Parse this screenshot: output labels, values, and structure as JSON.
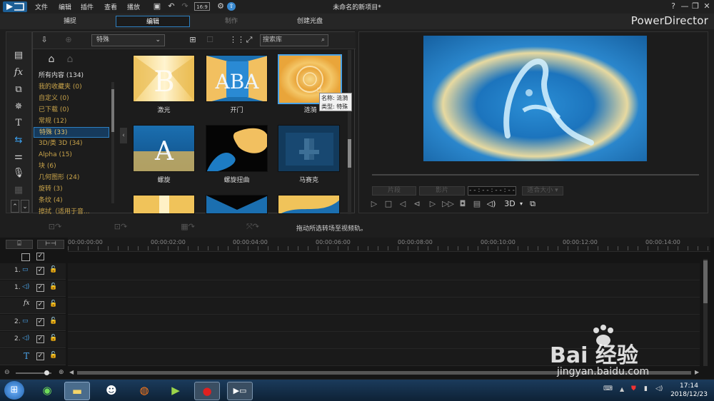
{
  "titlebar": {
    "menu": [
      "文件",
      "编辑",
      "插件",
      "查看",
      "播放"
    ],
    "window_title": "未命名的新项目*",
    "win_controls": [
      "?",
      "—",
      "❐",
      "✕"
    ]
  },
  "modes": {
    "tabs": [
      "捕捉",
      "编辑",
      "制作",
      "创建光盘"
    ],
    "active": "编辑"
  },
  "brand": "PowerDirector",
  "library": {
    "category_select": "特殊",
    "search_placeholder": "搜索库",
    "categories": [
      {
        "label": "所有内容 (134)"
      },
      {
        "label": "我的收藏夹 (0)"
      },
      {
        "label": "自定义 (0)"
      },
      {
        "label": "已下载 (0)"
      },
      {
        "label": "常规 (12)"
      },
      {
        "label": "特殊 (33)"
      },
      {
        "label": "3D/类 3D (34)"
      },
      {
        "label": "Alpha (15)"
      },
      {
        "label": "块 (6)"
      },
      {
        "label": "几何图形 (24)"
      },
      {
        "label": "旋转 (3)"
      },
      {
        "label": "条纹 (4)"
      },
      {
        "label": "擦拭（适用于音..."
      }
    ],
    "selected_category": "特殊 (33)",
    "thumbnails": [
      {
        "label": "激光"
      },
      {
        "label": "开门"
      },
      {
        "label": "涟漪"
      },
      {
        "label": "螺旋"
      },
      {
        "label": "螺旋扭曲"
      },
      {
        "label": "马赛克"
      }
    ],
    "tooltip": {
      "name": "名称: 涟漪",
      "type": "类型: 特殊"
    }
  },
  "preview": {
    "btn_left": "片段",
    "btn_right": "影片",
    "timecode": "- - : - - : - - : - -",
    "size_select": "适合大小",
    "threed": "3D"
  },
  "hint": "拖动所选转场至视频轨。",
  "timeline": {
    "ruler": [
      "00:00:00:00",
      "00:00:02:00",
      "00:00:04:00",
      "00:00:06:00",
      "00:00:08:00",
      "00:00:10:00",
      "00:00:12:00",
      "00:00:14:00"
    ],
    "tracks": [
      {
        "num": "1.",
        "icon": "video-track-icon"
      },
      {
        "num": "1.",
        "icon": "audio-track-icon"
      },
      {
        "num": "",
        "icon": "fx-track-icon"
      },
      {
        "num": "2.",
        "icon": "video-track-icon"
      },
      {
        "num": "2.",
        "icon": "audio-track-icon"
      },
      {
        "num": "",
        "icon": "title-track-icon"
      }
    ]
  },
  "taskbar": {
    "time": "17:14",
    "date": "2018/12/23"
  },
  "watermark": {
    "main": "Bai 经验",
    "url": "jingyan.baidu.com"
  },
  "colors": {
    "accent": "#2d7fc0",
    "category_text": "#c8a34a",
    "preview_blue": "#1e7fc4"
  }
}
